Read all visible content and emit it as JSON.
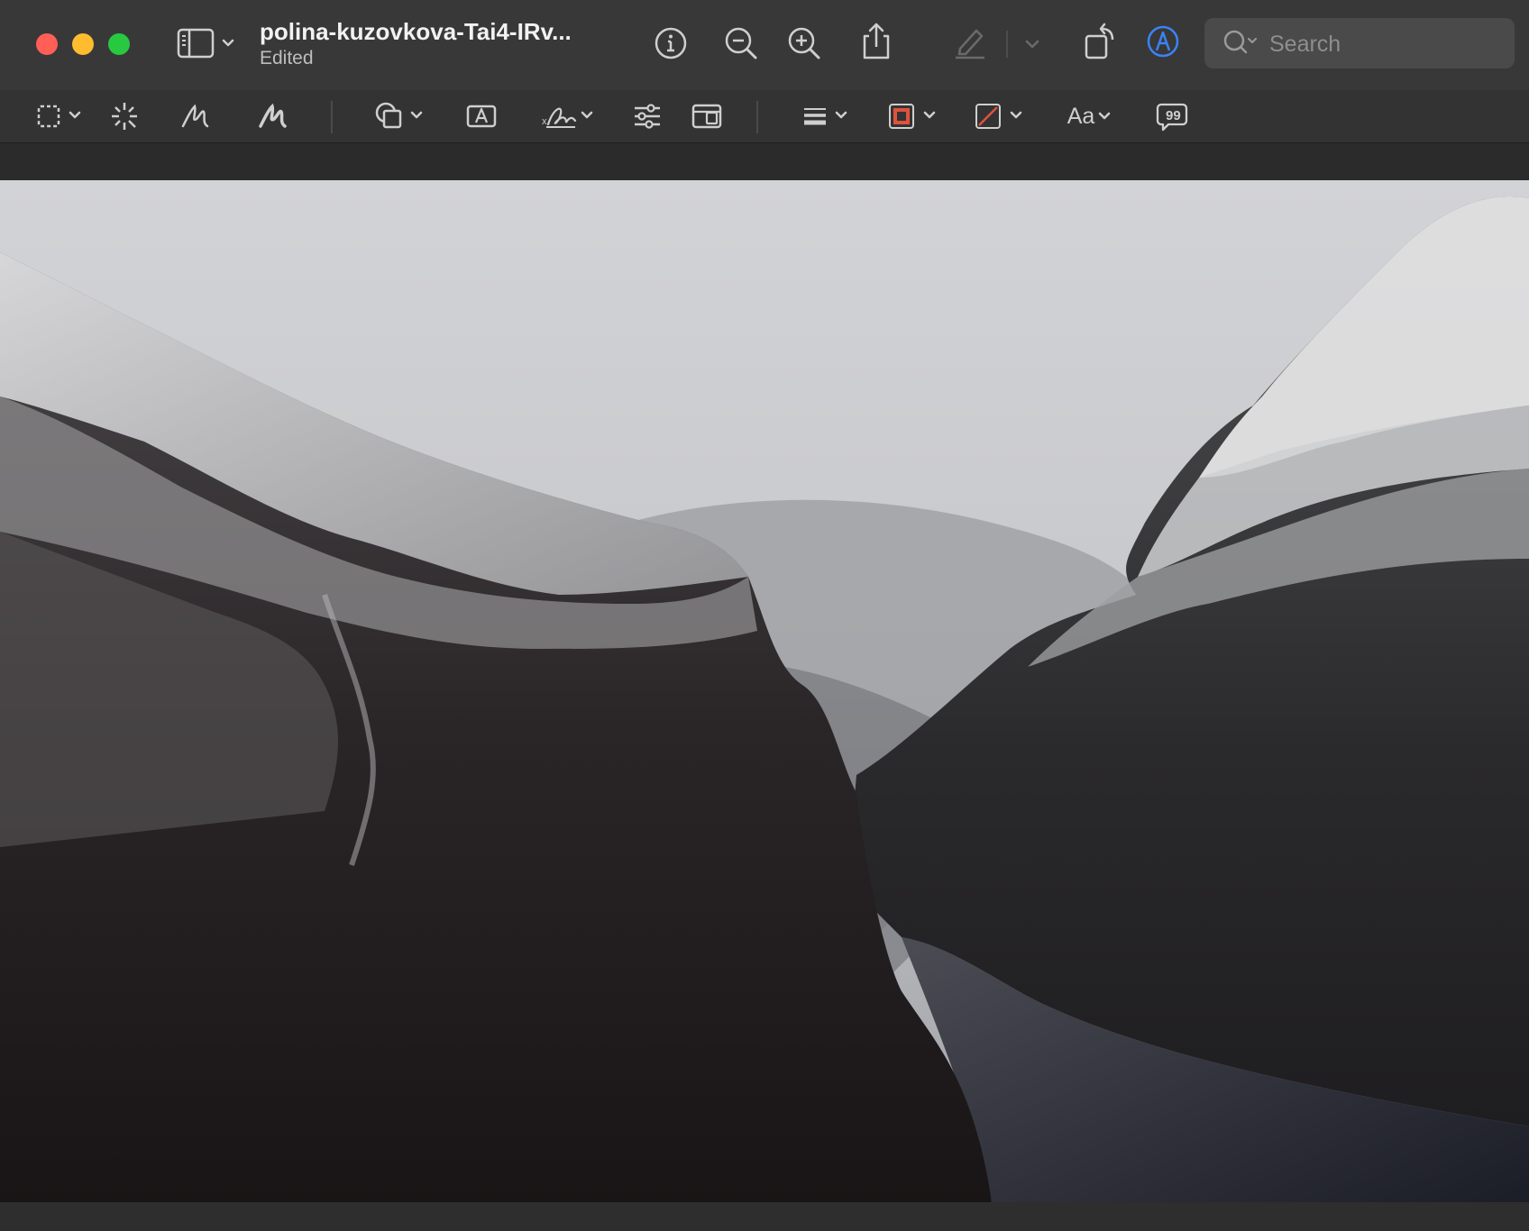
{
  "window": {
    "title": "polina-kuzovkova-Tai4-IRv...",
    "subtitle": "Edited"
  },
  "search": {
    "placeholder": "Search",
    "value": ""
  },
  "toolbar": {
    "icons": [
      "sidebar-icon",
      "info-icon",
      "zoom-out-icon",
      "zoom-in-icon",
      "share-icon",
      "highlight-icon",
      "rotate-icon",
      "markup-icon"
    ]
  },
  "markup": {
    "font_label": "Aa",
    "border_color": "#e0523c",
    "fill_color_slash": "#e0523c"
  },
  "colors": {
    "accent": "#3b82f6",
    "close": "#ff5f57",
    "minimize": "#febc2e",
    "maximize": "#28c840"
  },
  "image": {
    "subject": "snowy-fjord-mountains"
  }
}
